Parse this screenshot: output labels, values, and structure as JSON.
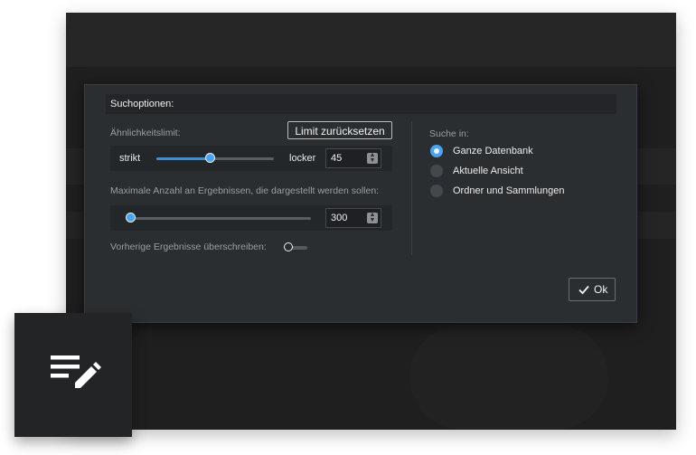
{
  "dialog": {
    "header": "Suchoptionen:",
    "similarity_label": "Ähnlichkeitslimit:",
    "reset_button": "Limit zurücksetzen",
    "slider_min_label": "strikt",
    "slider_max_label": "locker",
    "similarity_value": "45",
    "similarity_fraction": 0.45,
    "max_results_label": "Maximale Anzahl an Ergebnissen, die dargestellt werden sollen:",
    "max_results_value": "300",
    "max_results_fraction": 0.02,
    "overwrite_label": "Vorherige Ergebnisse überschreiben:",
    "overwrite_enabled": false,
    "search_in_label": "Suche in:",
    "search_options": [
      {
        "label": "Ganze Datenbank",
        "checked": true
      },
      {
        "label": "Aktuelle Ansicht",
        "checked": false
      },
      {
        "label": "Ordner und Sammlungen",
        "checked": false
      }
    ],
    "ok_button": "Ok"
  },
  "icons": {
    "ok_check": "check-icon",
    "badge": "edit-list-icon"
  },
  "colors": {
    "accent": "#4aa3f0",
    "dialog_bg": "#2b2e31"
  }
}
